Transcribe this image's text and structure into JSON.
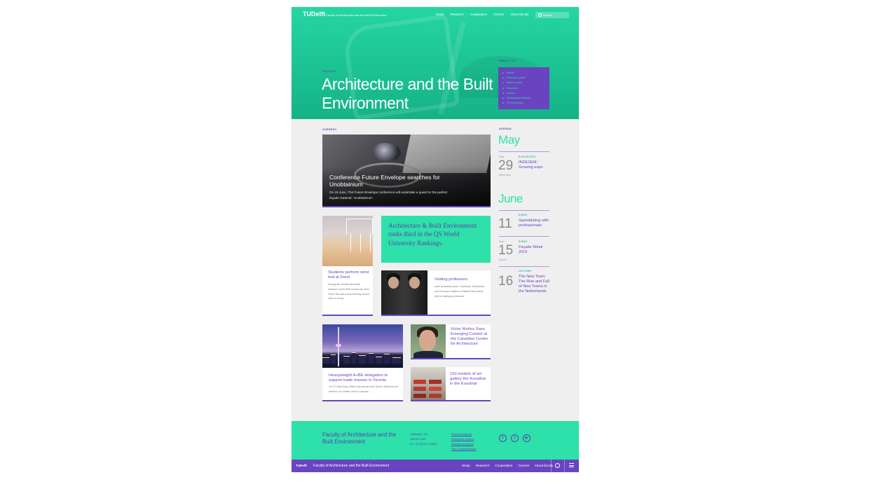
{
  "header": {
    "logo": "TUDelft",
    "faculty": "Faculty of Architecture and the Built Environment",
    "nav": [
      "Study",
      "Research",
      "Cooperation",
      "Current",
      "About faculty"
    ],
    "search_placeholder": "Search"
  },
  "hero": {
    "eyebrow": "FACULTY",
    "title": "Architecture and the Built Environment",
    "direct_label": "DIRECT TO",
    "direct_links": [
      "Alumni",
      "Employee portal",
      "Student portal",
      "Vacancies",
      "Contact",
      "International students",
      "TU Delft library"
    ]
  },
  "current": {
    "label": "CURRENT",
    "feature": {
      "title": "Conference Future Envelope searches for Unobtainium",
      "desc": "On 18 June, The Future Envelope conference will undertake a quest for the perfect façade material: 'Unobtainium'."
    },
    "cards": {
      "beach": {
        "title": "Students perform wind test at Derol",
        "desc": "During the festival students measure sand drift caused by wind. There are also dune-friendly beach huts on show."
      },
      "ranks": {
        "title": "Architecture & Built Environment ranks third in the QS World University Rankings."
      },
      "professors": {
        "title": "Visiting professors",
        "desc": "Next academic year, Yoshiharu Tsukamoto and Momoyo Kaijima of Atelier Bow-Wow will be visiting professors."
      },
      "toronto": {
        "title": "Heavyweight A+BE delegation to support trade mission in Toronto",
        "desc": "On 27 May King Willem-Alexander and Queen Máxima will embark on a state visit to Canada."
      },
      "victor": {
        "title": "Víctor Muñoz Sanz Emerging Curator at the Canadian Center for Architecture"
      },
      "models": {
        "title": "150 models of art-gallery the Kunsthal in the Kunsthal"
      }
    }
  },
  "agenda": {
    "label": "AGENDA",
    "months": [
      {
        "name": "May",
        "events": [
          {
            "pre": "From",
            "day": "29",
            "post": "Until 5 June",
            "type": "EXPOSITION",
            "title": "INDESEM: Growing expo"
          }
        ]
      },
      {
        "name": "June",
        "events": [
          {
            "pre": "",
            "day": "11",
            "post": "",
            "type": "EVENT",
            "title": "Speeddating with professionals"
          },
          {
            "pre": "From",
            "day": "15",
            "post": "Until 19",
            "type": "EVENT",
            "title": "Façade Week 2015"
          },
          {
            "pre": "",
            "day": "16",
            "post": "",
            "type": "LECTURE",
            "title": "The New Town: The Rise and Fall of New Towns in the Netherlands"
          }
        ]
      }
    ]
  },
  "footer": {
    "name": "Faculty of Architecture and the Built Environment",
    "address": [
      "Julianalaan 134",
      "2628 BL Delft",
      "Tel. +31 (0)15 27 89805"
    ],
    "links": [
      "Routebeschrijving",
      "Plattegrond campus",
      "Plattegrond gebouw",
      "Open parkeerplaatsen"
    ],
    "social": [
      "f",
      "t",
      "▶"
    ]
  },
  "bottombar": {
    "logo": "TUDelft",
    "faculty": "Faculty of Architecture and the Built Environment",
    "nav": [
      "Study",
      "Research",
      "Cooperation",
      "Current",
      "About faculty"
    ]
  },
  "colors": {
    "accent_green": "#2ee0aa",
    "accent_purple": "#6a44c0",
    "background": "#efefef"
  }
}
